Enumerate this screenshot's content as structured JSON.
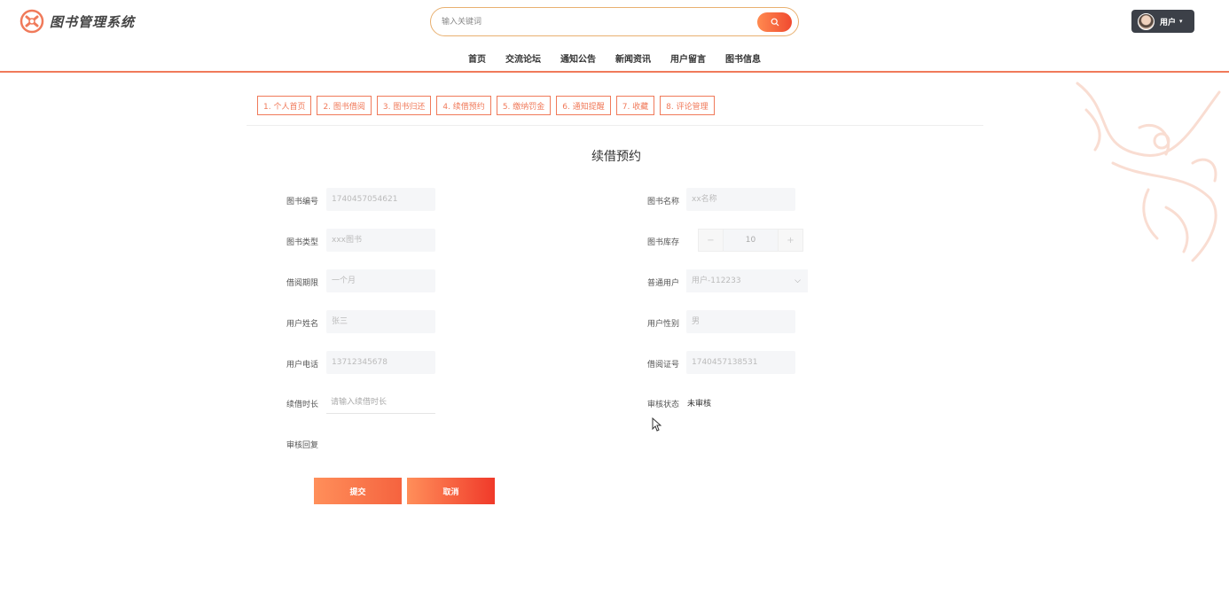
{
  "app": {
    "title": "图书管理系统"
  },
  "search": {
    "placeholder": "输入关键词"
  },
  "user_menu": {
    "label": "用户"
  },
  "nav": [
    {
      "label": "首页"
    },
    {
      "label": "交流论坛"
    },
    {
      "label": "通知公告"
    },
    {
      "label": "新闻资讯"
    },
    {
      "label": "用户留言"
    },
    {
      "label": "图书信息"
    }
  ],
  "tabs": [
    {
      "label": "1. 个人首页"
    },
    {
      "label": "2. 图书借阅"
    },
    {
      "label": "3. 图书归还"
    },
    {
      "label": "4. 续借预约"
    },
    {
      "label": "5. 缴纳罚金"
    },
    {
      "label": "6. 通知提醒"
    },
    {
      "label": "7. 收藏"
    },
    {
      "label": "8. 评论管理"
    }
  ],
  "form": {
    "title": "续借预约",
    "book_no": {
      "label": "图书编号",
      "value": "1740457054621"
    },
    "book_name": {
      "label": "图书名称",
      "value": "xx名称"
    },
    "book_type": {
      "label": "图书类型",
      "value": "xxx图书"
    },
    "stock": {
      "label": "图书库存",
      "value": "10",
      "minus": "−",
      "plus": "+"
    },
    "period": {
      "label": "借阅期限",
      "value": "一个月"
    },
    "user": {
      "label": "普通用户",
      "value": "用户-112233"
    },
    "user_name": {
      "label": "用户姓名",
      "value": "张三"
    },
    "user_gender": {
      "label": "用户性别",
      "value": "男"
    },
    "user_phone": {
      "label": "用户电话",
      "value": "13712345678"
    },
    "card_no": {
      "label": "借阅证号",
      "value": "1740457138531"
    },
    "renew_duration": {
      "label": "续借时长",
      "placeholder": "请输入续借时长"
    },
    "review_status": {
      "label": "审核状态",
      "value": "未审核"
    },
    "review_reply": {
      "label": "审核回复"
    },
    "submit": "提交",
    "cancel": "取消"
  },
  "colors": {
    "accent": "#f07a5a",
    "accent_dark": "#f04a30",
    "user_button": "#3c4048"
  }
}
